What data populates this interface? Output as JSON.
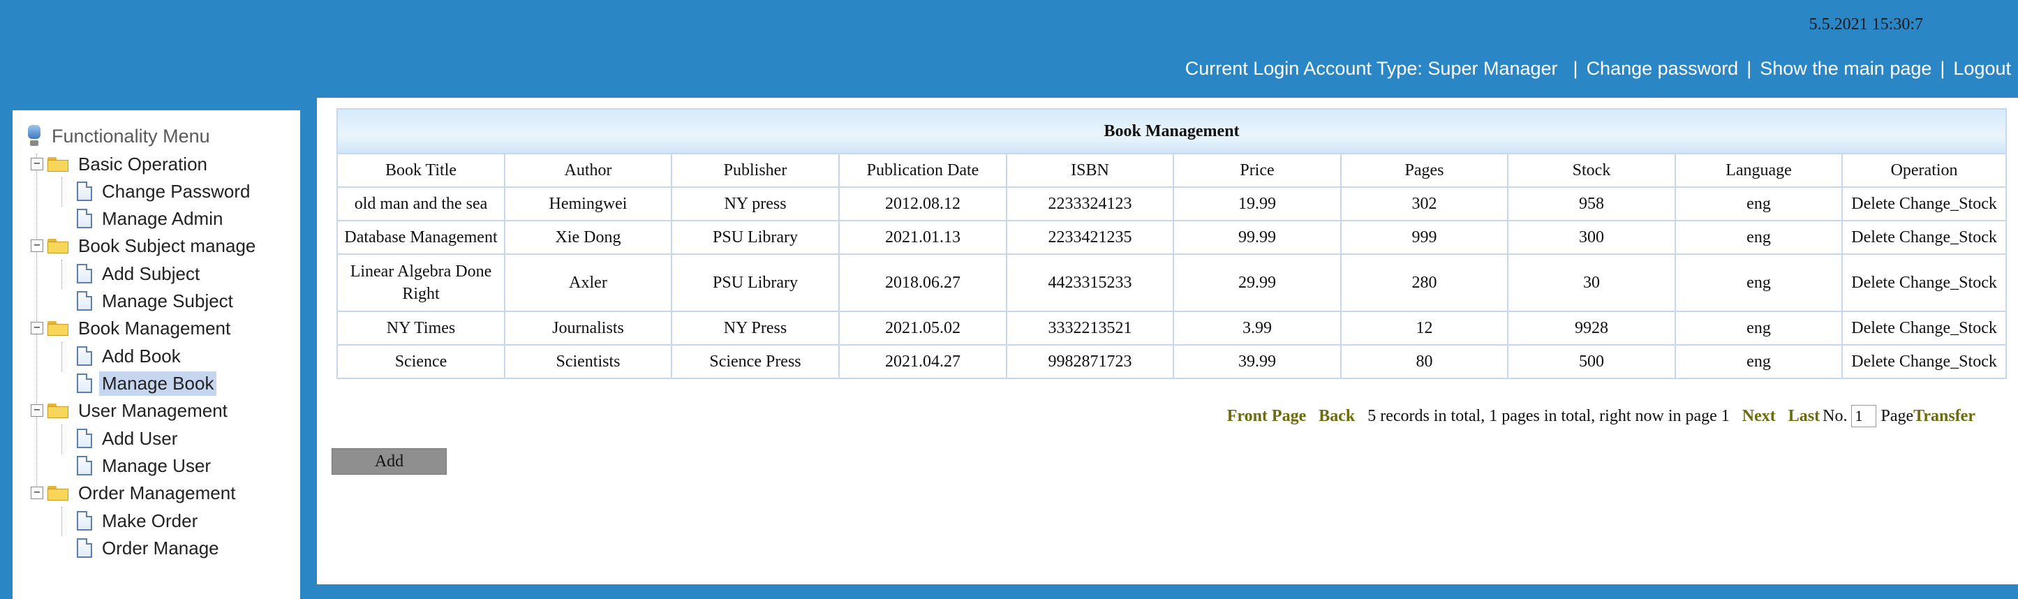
{
  "header": {
    "datetime": "5.5.2021 15:30:7",
    "account_type": "Current Login Account Type: Super Manager",
    "links": {
      "change_password": "Change password",
      "show_main": "Show the main page",
      "logout": "Logout"
    }
  },
  "sidebar": {
    "title": "Functionality Menu",
    "groups": [
      {
        "label": "Basic Operation",
        "items": [
          {
            "label": "Change Password"
          },
          {
            "label": "Manage Admin"
          }
        ]
      },
      {
        "label": "Book Subject manage",
        "items": [
          {
            "label": "Add Subject"
          },
          {
            "label": "Manage Subject"
          }
        ]
      },
      {
        "label": "Book Management",
        "items": [
          {
            "label": "Add Book"
          },
          {
            "label": "Manage Book",
            "active": true
          }
        ]
      },
      {
        "label": "User Management",
        "items": [
          {
            "label": "Add User"
          },
          {
            "label": "Manage User"
          }
        ]
      },
      {
        "label": "Order Management",
        "items": [
          {
            "label": "Make Order"
          },
          {
            "label": "Order Manage"
          }
        ]
      }
    ]
  },
  "table": {
    "title": "Book Management",
    "columns": [
      "Book Title",
      "Author",
      "Publisher",
      "Publication Date",
      "ISBN",
      "Price",
      "Pages",
      "Stock",
      "Language",
      "Operation"
    ],
    "rows": [
      [
        "old man and the sea",
        "Hemingwei",
        "NY press",
        "2012.08.12",
        "2233324123",
        "19.99",
        "302",
        "958",
        "eng"
      ],
      [
        "Database Management",
        "Xie Dong",
        "PSU Library",
        "2021.01.13",
        "2233421235",
        "99.99",
        "999",
        "300",
        "eng"
      ],
      [
        "Linear Algebra Done Right",
        "Axler",
        "PSU Library",
        "2018.06.27",
        "4423315233",
        "29.99",
        "280",
        "30",
        "eng"
      ],
      [
        "NY Times",
        "Journalists",
        "NY Press",
        "2021.05.02",
        "3332213521",
        "3.99",
        "12",
        "9928",
        "eng"
      ],
      [
        "Science",
        "Scientists",
        "Science Press",
        "2021.04.27",
        "9982871723",
        "39.99",
        "80",
        "500",
        "eng"
      ]
    ],
    "operations": {
      "delete": "Delete",
      "change_stock": "Change_Stock"
    }
  },
  "pager": {
    "front": "Front Page",
    "back": "Back",
    "summary": "5 records in total, 1 pages in total, right now in page 1",
    "next": "Next",
    "last": "Last",
    "no_label": "No.",
    "page_value": "1",
    "page_label": "Page",
    "transfer": "Transfer"
  },
  "add_button": "Add",
  "colors": {
    "header_bg": "#2a86c4",
    "table_border": "#c7d7ef",
    "pager_link": "#6b6b10",
    "active_item_bg": "#c5d6ee"
  }
}
